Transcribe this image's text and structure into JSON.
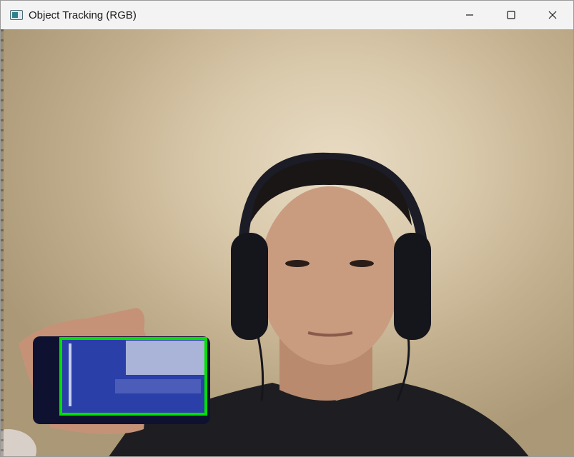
{
  "window": {
    "title": "Object Tracking (RGB)",
    "icon": "app-window-icon",
    "controls": {
      "minimize_icon": "minimize-icon",
      "maximize_icon": "maximize-icon",
      "close_icon": "close-icon"
    }
  },
  "video": {
    "tracking_box_color": "#00e000"
  }
}
